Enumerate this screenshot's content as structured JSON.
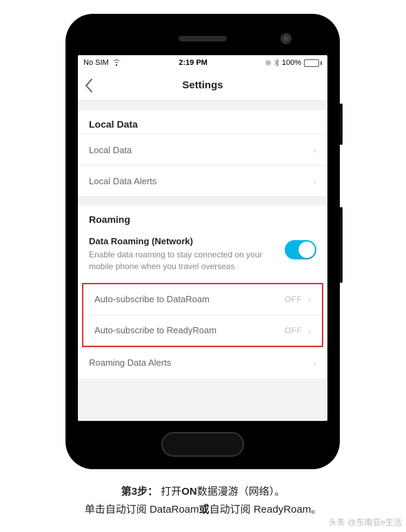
{
  "statusbar": {
    "carrier": "No SIM",
    "time": "2:19 PM",
    "battery_pct": "100%"
  },
  "nav": {
    "title": "Settings"
  },
  "sections": {
    "local": {
      "header": "Local Data",
      "rows": {
        "local_data": "Local Data",
        "alerts": "Local Data Alerts"
      }
    },
    "roaming": {
      "header": "Roaming",
      "subhead": "Data Roaming (Network)",
      "desc": "Enable data roaming to stay connected on your mobile phone when you travel overseas",
      "toggle_on": true,
      "auto_dataroam": {
        "label": "Auto-subscribe to DataRoam",
        "value": "OFF"
      },
      "auto_readyroam": {
        "label": "Auto-subscribe to ReadyRoam",
        "value": "OFF"
      },
      "alerts": "Roaming Data Alerts"
    }
  },
  "caption": {
    "line1_a": "第3步：",
    "line1_b": "打开",
    "line1_c": "ON",
    "line1_d": "数据漫游（网络）。",
    "line2_a": "单击自动订阅 DataRoam",
    "line2_b": "或",
    "line2_c": "自动订阅 ReadyRoam。"
  },
  "watermark": "头条 @东南亚e生活"
}
